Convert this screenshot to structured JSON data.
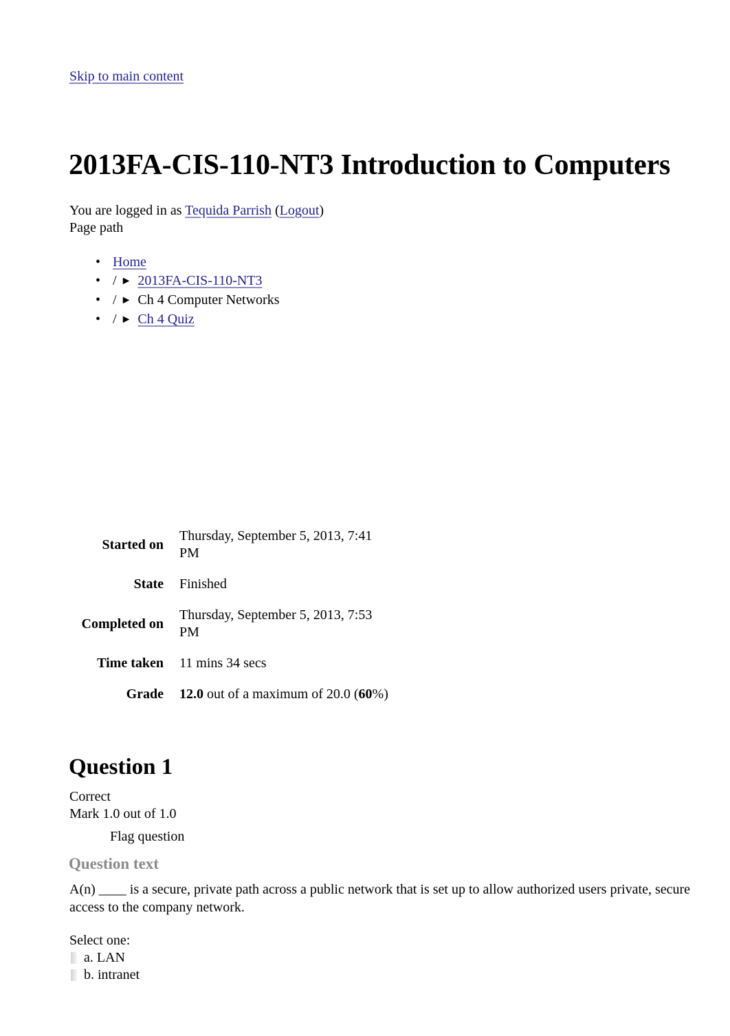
{
  "accessibility": {
    "skip_link": "Skip to main content"
  },
  "header": {
    "title": "2013FA-CIS-110-NT3 Introduction to Computers"
  },
  "userinfo": {
    "prefix": "You are logged in as ",
    "user_name": "Tequida Parrish",
    "open_paren": " (",
    "logout_label": "Logout",
    "close_paren": ")",
    "page_path_label": "Page path"
  },
  "breadcrumb": {
    "items": [
      {
        "separator": "",
        "arrow": "",
        "label": "Home",
        "is_link": true
      },
      {
        "separator": "/",
        "arrow": "►",
        "label": "2013FA-CIS-110-NT3",
        "is_link": true
      },
      {
        "separator": "/",
        "arrow": "►",
        "label": "Ch 4 Computer Networks",
        "is_link": false
      },
      {
        "separator": "/",
        "arrow": "►",
        "label": "Ch 4 Quiz",
        "is_link": true
      }
    ]
  },
  "attempt_summary": {
    "rows": [
      {
        "label": "Started on",
        "value": "Thursday, September 5, 2013, 7:41 PM"
      },
      {
        "label": "State",
        "value": "Finished"
      },
      {
        "label": "Completed on",
        "value": "Thursday, September 5, 2013, 7:53 PM"
      },
      {
        "label": "Time taken",
        "value": "11 mins 34 secs"
      }
    ],
    "grade": {
      "label": "Grade",
      "score": "12.0",
      "middle": " out of a maximum of 20.0 (",
      "percent": "60",
      "percent_suffix": "%)"
    }
  },
  "question": {
    "heading": "Question 1",
    "state": "Correct",
    "mark": "Mark 1.0 out of 1.0",
    "flag_label": "Flag question",
    "question_text_heading": "Question text",
    "text": "A(n) ____ is a secure, private path across a public network that is set up to allow authorized users private, secure access to the company network.",
    "select_prompt": "Select one:",
    "options": [
      {
        "letter": "a.",
        "label": "LAN",
        "selected": false
      },
      {
        "letter": "b.",
        "label": "intranet",
        "selected": false
      }
    ]
  },
  "colors": {
    "link": "#22228C",
    "muted_heading": "#8A8A8A",
    "text": "#000000",
    "background": "#FFFFFF"
  }
}
